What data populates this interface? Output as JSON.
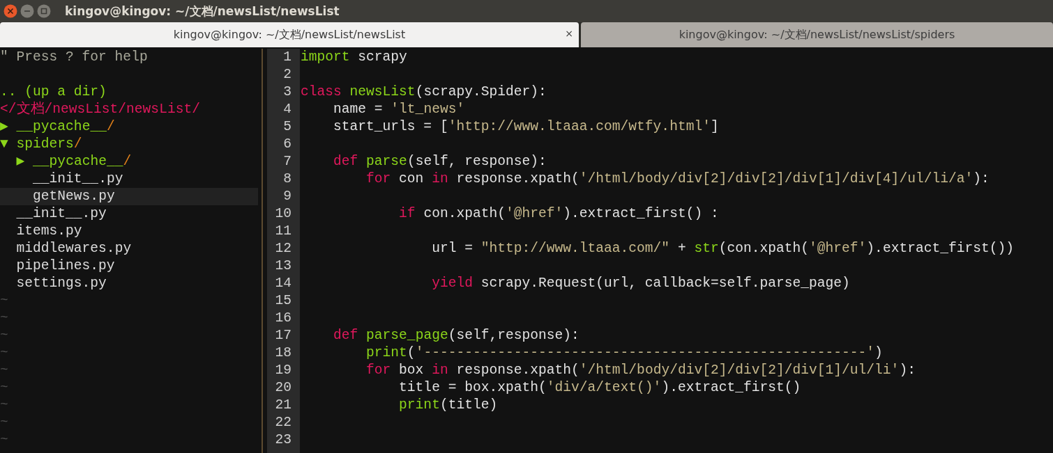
{
  "window": {
    "title": "kingov@kingov: ~/文档/newsList/newsList"
  },
  "tabs": [
    {
      "label": "kingov@kingov: ~/文档/newsList/newsList",
      "selected": true,
      "close": "×"
    },
    {
      "label": "kingov@kingov: ~/文档/newsList/newsList/spiders",
      "selected": false
    }
  ],
  "file_tree": {
    "help": "\" Press ? for help",
    "up_dir": ".. (up a dir)",
    "path": "</文档/newsList/newsList/",
    "items": [
      {
        "kind": "dir",
        "marker": "▶",
        "name": "__pycache__",
        "suffix": "/",
        "selected": false
      },
      {
        "kind": "dir",
        "marker": "▼",
        "name": "spiders",
        "suffix": "/",
        "selected": false,
        "children": [
          {
            "kind": "dir",
            "marker": "▶",
            "name": "__pycache__",
            "suffix": "/",
            "selected": false
          },
          {
            "kind": "file",
            "name": "__init__.py",
            "selected": false
          },
          {
            "kind": "file",
            "name": "getNews.py",
            "selected": true
          }
        ]
      },
      {
        "kind": "file",
        "name": "__init__.py",
        "selected": false
      },
      {
        "kind": "file",
        "name": "items.py",
        "selected": false
      },
      {
        "kind": "file",
        "name": "middlewares.py",
        "selected": false
      },
      {
        "kind": "file",
        "name": "pipelines.py",
        "selected": false
      },
      {
        "kind": "file",
        "name": "settings.py",
        "selected": false
      }
    ],
    "filler": [
      "~",
      "~",
      "~",
      "~",
      "~",
      "~",
      "~",
      "~",
      "~"
    ]
  },
  "editor": {
    "lines": [
      {
        "number": "1",
        "tokens": [
          {
            "kind": "function",
            "text": "import"
          },
          {
            "kind": "plain",
            "text": " scrapy"
          }
        ]
      },
      {
        "number": "2"
      },
      {
        "number": "3",
        "tokens": [
          {
            "kind": "keyword",
            "text": "class "
          },
          {
            "kind": "function",
            "text": "newsList"
          },
          {
            "kind": "plain",
            "text": "(scrapy.Spider):"
          }
        ]
      },
      {
        "number": "4",
        "tokens": [
          {
            "kind": "plain",
            "text": "    name = "
          },
          {
            "kind": "string",
            "text": "'lt_news'"
          }
        ]
      },
      {
        "number": "5",
        "tokens": [
          {
            "kind": "plain",
            "text": "    start_urls = ["
          },
          {
            "kind": "string",
            "text": "'http://www.ltaaa.com/wtfy.html'"
          },
          {
            "kind": "plain",
            "text": "]"
          }
        ]
      },
      {
        "number": "6"
      },
      {
        "number": "7",
        "tokens": [
          {
            "kind": "keyword",
            "text": "    def "
          },
          {
            "kind": "function",
            "text": "parse"
          },
          {
            "kind": "plain",
            "text": "(self, response):"
          }
        ]
      },
      {
        "number": "8",
        "tokens": [
          {
            "kind": "keyword",
            "text": "        for"
          },
          {
            "kind": "plain",
            "text": " con "
          },
          {
            "kind": "keyword",
            "text": "in"
          },
          {
            "kind": "plain",
            "text": " response.xpath("
          },
          {
            "kind": "string",
            "text": "'/html/body/div[2]/div[2]/div[1]/div[4]/ul/li/a'"
          },
          {
            "kind": "plain",
            "text": "):"
          }
        ]
      },
      {
        "number": "9"
      },
      {
        "number": "10",
        "tokens": [
          {
            "kind": "keyword",
            "text": "            if"
          },
          {
            "kind": "plain",
            "text": " con.xpath("
          },
          {
            "kind": "string",
            "text": "'@href'"
          },
          {
            "kind": "plain",
            "text": ").extract_first() :"
          }
        ]
      },
      {
        "number": "11"
      },
      {
        "number": "12",
        "tokens": [
          {
            "kind": "plain",
            "text": "                url = "
          },
          {
            "kind": "string",
            "text": "\"http://www.ltaaa.com/\""
          },
          {
            "kind": "plain",
            "text": " + "
          },
          {
            "kind": "function",
            "text": "str"
          },
          {
            "kind": "plain",
            "text": "(con.xpath("
          },
          {
            "kind": "string",
            "text": "'@href'"
          },
          {
            "kind": "plain",
            "text": ").extract_first())"
          }
        ]
      },
      {
        "number": "13"
      },
      {
        "number": "14",
        "tokens": [
          {
            "kind": "keyword",
            "text": "                yield"
          },
          {
            "kind": "plain",
            "text": " scrapy.Request(url, callback=self.parse_page)"
          }
        ]
      },
      {
        "number": "15"
      },
      {
        "number": "16"
      },
      {
        "number": "17",
        "tokens": [
          {
            "kind": "keyword",
            "text": "    def "
          },
          {
            "kind": "function",
            "text": "parse_page"
          },
          {
            "kind": "plain",
            "text": "(self,response):"
          }
        ]
      },
      {
        "number": "18",
        "tokens": [
          {
            "kind": "function",
            "text": "        print"
          },
          {
            "kind": "plain",
            "text": "("
          },
          {
            "kind": "string",
            "text": "'------------------------------------------------------'"
          },
          {
            "kind": "plain",
            "text": ")"
          }
        ]
      },
      {
        "number": "19",
        "tokens": [
          {
            "kind": "keyword",
            "text": "        for"
          },
          {
            "kind": "plain",
            "text": " box "
          },
          {
            "kind": "keyword",
            "text": "in"
          },
          {
            "kind": "plain",
            "text": " response.xpath("
          },
          {
            "kind": "string",
            "text": "'/html/body/div[2]/div[2]/div[1]/ul/li'"
          },
          {
            "kind": "plain",
            "text": "):"
          }
        ]
      },
      {
        "number": "20",
        "tokens": [
          {
            "kind": "plain",
            "text": "            title = box.xpath("
          },
          {
            "kind": "string",
            "text": "'div/a/text()'"
          },
          {
            "kind": "plain",
            "text": ").extract_first()"
          }
        ]
      },
      {
        "number": "21",
        "tokens": [
          {
            "kind": "function",
            "text": "            print"
          },
          {
            "kind": "plain",
            "text": "(title)"
          }
        ]
      },
      {
        "number": "22"
      },
      {
        "number": "23"
      }
    ]
  }
}
